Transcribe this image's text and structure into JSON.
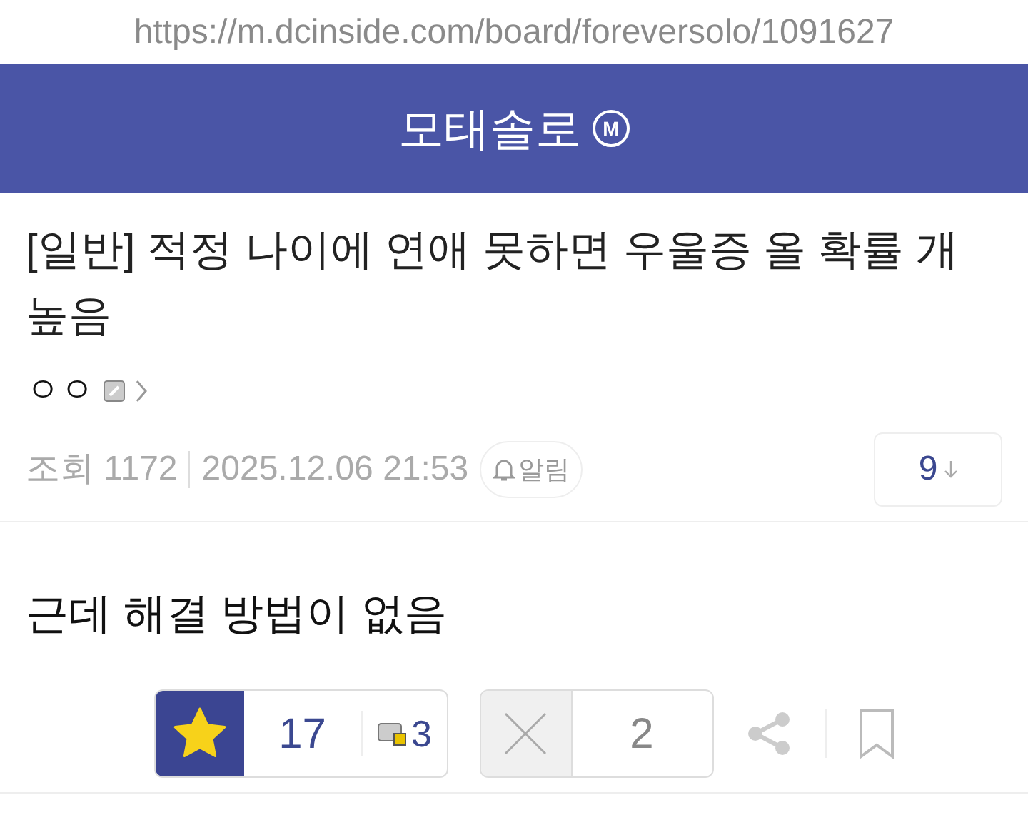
{
  "url": "https://m.dcinside.com/board/foreversolo/1091627",
  "header": {
    "title": "모태솔로",
    "badge": "M"
  },
  "post": {
    "title": "[일반] 적정 나이에 연애 못하면 우울증 올 확률 개 높음",
    "author": "ㅇㅇ",
    "views": "조회 1172",
    "date": "2025.12.06 21:53",
    "alert_button": "알림",
    "comments_button": "9",
    "body": "근데 해결 방법이 없음",
    "recommend": {
      "count": "17",
      "fixed_count": "3"
    },
    "dislike": {
      "count": "2"
    }
  }
}
